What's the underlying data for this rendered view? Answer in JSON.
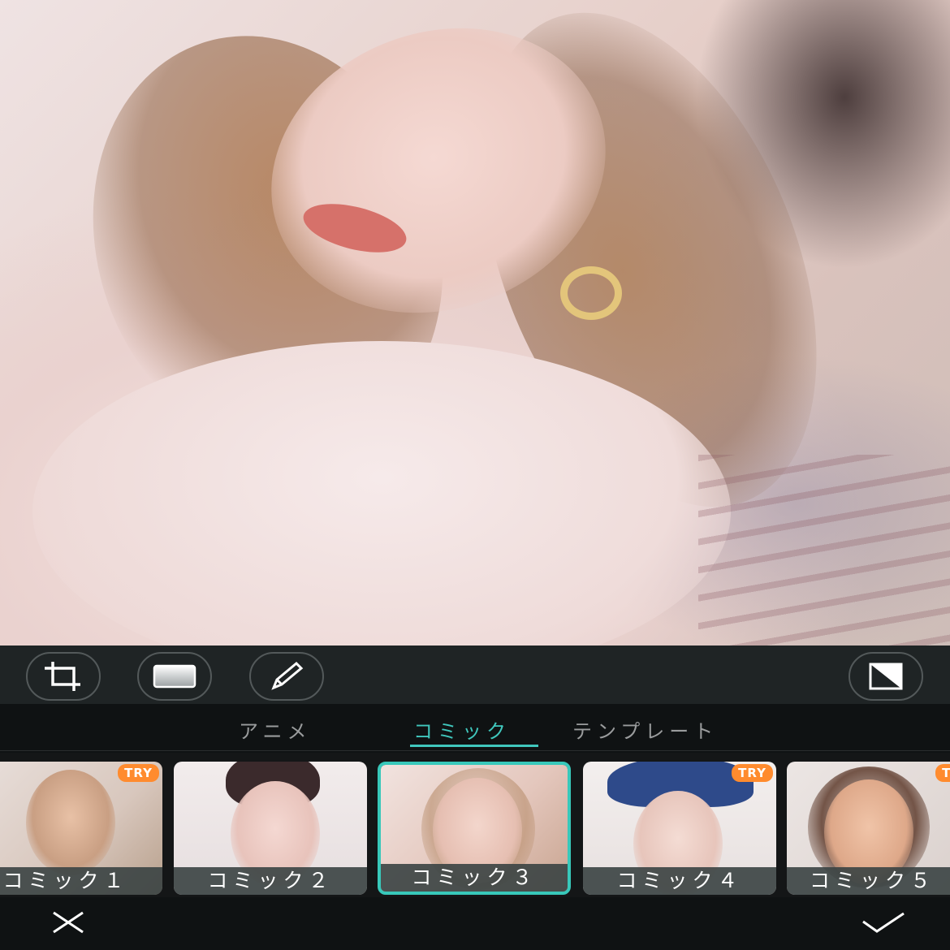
{
  "photo": {
    "description_icon": "edited-photo"
  },
  "toolbar": {
    "tools": [
      {
        "name": "crop",
        "icon": "crop-icon"
      },
      {
        "name": "frame",
        "icon": "rectangle-icon"
      },
      {
        "name": "draw",
        "icon": "pencil-icon"
      },
      {
        "name": "compare",
        "icon": "compare-icon"
      }
    ]
  },
  "tabs": {
    "items": [
      {
        "label": "アニメ"
      },
      {
        "label": "コミック"
      },
      {
        "label": "テンプレート"
      }
    ],
    "active_index": 1
  },
  "styles": {
    "items": [
      {
        "label": "コミック１",
        "badge": "TRY"
      },
      {
        "label": "コミック２",
        "badge": ""
      },
      {
        "label": "コミック３",
        "badge": ""
      },
      {
        "label": "コミック４",
        "badge": "TRY"
      },
      {
        "label": "コミック５",
        "badge": "TRY"
      }
    ],
    "selected_index": 2
  },
  "bottom": {
    "cancel_icon": "close-icon",
    "confirm_icon": "checkmark-icon"
  },
  "colors": {
    "accent": "#40c7bd",
    "badge": "#ff8b2e",
    "toolbar_bg": "#1f2425",
    "panel_bg": "#0f1213"
  }
}
